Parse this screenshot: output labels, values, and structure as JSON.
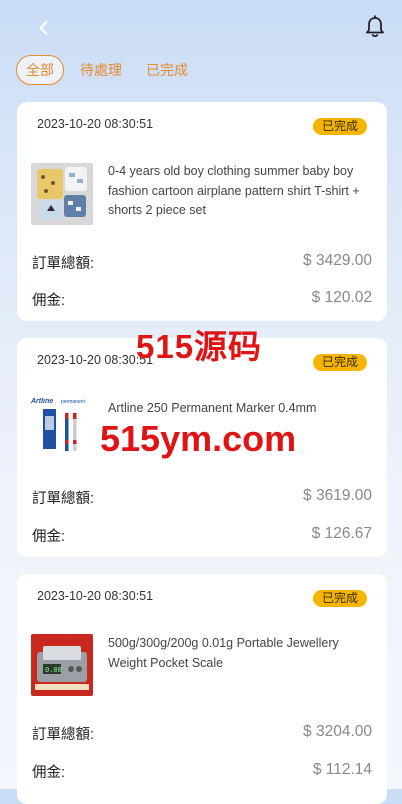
{
  "header": {
    "back_icon": "chevron-left-icon",
    "bell_icon": "bell-icon"
  },
  "tabs": [
    {
      "label": "全部",
      "active": true
    },
    {
      "label": "待處理",
      "active": false
    },
    {
      "label": "已完成",
      "active": false
    }
  ],
  "orders": [
    {
      "date": "2023-10-20 08:30:51",
      "status": "已完成",
      "product_name": "0-4 years old boy clothing summer baby boy fashion cartoon airplane pattern shirt T-shirt + shorts 2 piece set",
      "total_label": "訂單總額:",
      "total_value": "$ 3429.00",
      "commission_label": "佣金:",
      "commission_value": "$ 120.02"
    },
    {
      "date": "2023-10-20 08:30:51",
      "status": "已完成",
      "product_name": "Artline 250 Permanent Marker 0.4mm",
      "total_label": "訂單總額:",
      "total_value": "$ 3619.00",
      "commission_label": "佣金:",
      "commission_value": "$ 126.67",
      "thumb_text": {
        "brand": "Artline",
        "sub": "permanent"
      }
    },
    {
      "date": "2023-10-20 08:30:51",
      "status": "已完成",
      "product_name": "500g/300g/200g 0.01g Portable Jewellery Weight Pocket Scale",
      "total_label": "訂單總額:",
      "total_value": "$ 3204.00",
      "commission_label": "佣金:",
      "commission_value": "$ 112.14"
    }
  ],
  "watermark": {
    "line1": "515源码",
    "line2": "515ym.com"
  },
  "colors": {
    "accent": "#e58a2e",
    "badge": "#f5b400",
    "watermark": "#e01414"
  }
}
